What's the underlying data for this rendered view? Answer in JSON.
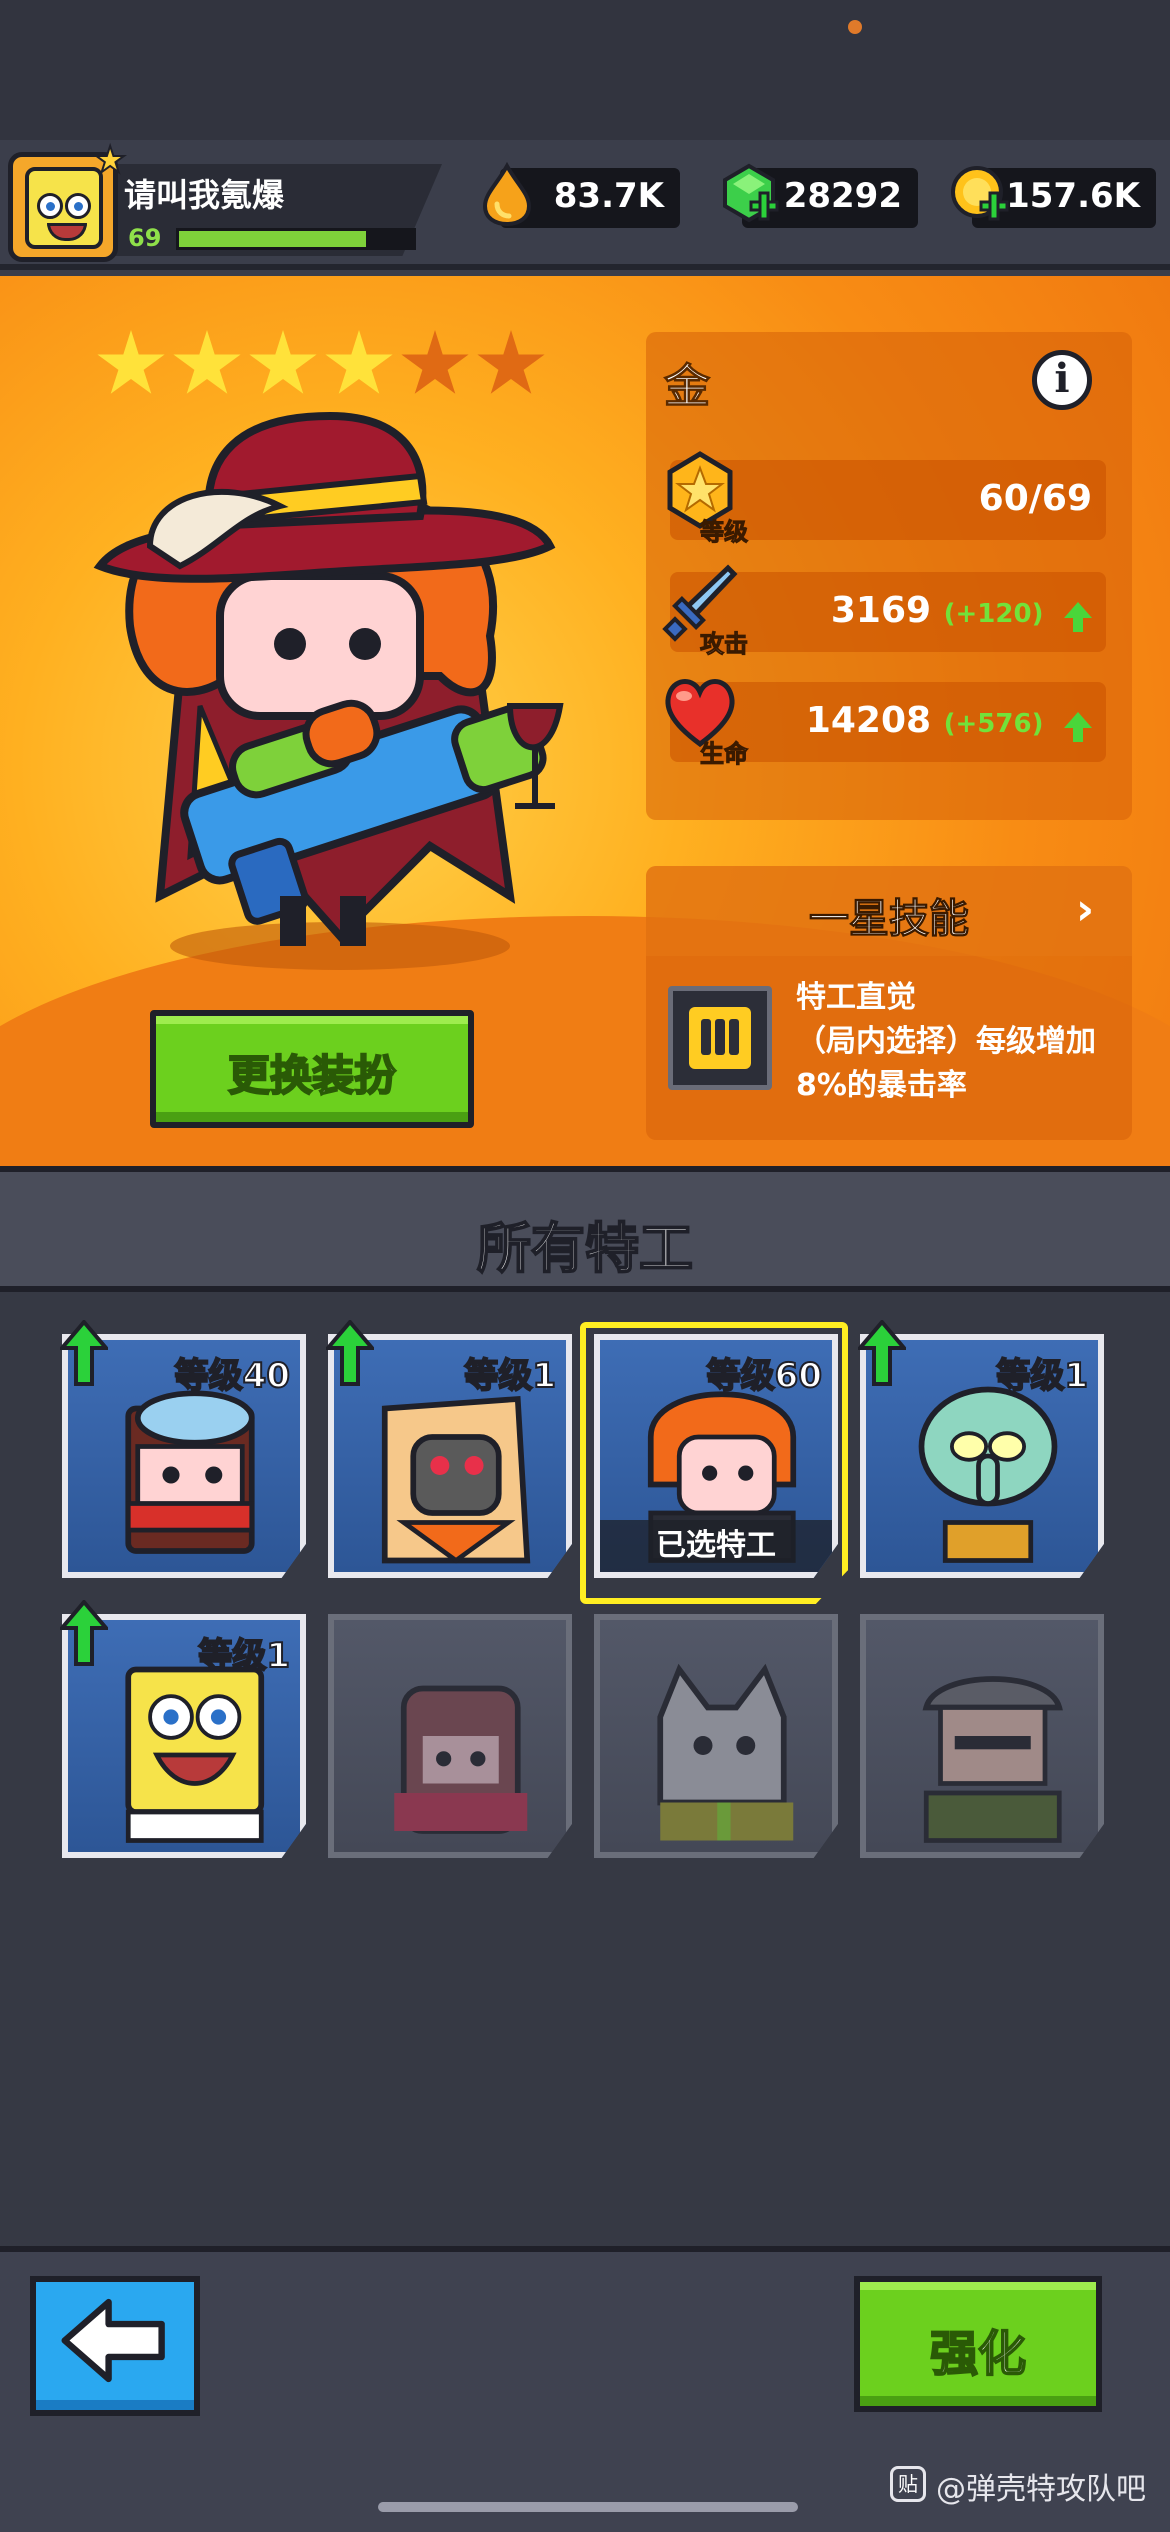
{
  "player": {
    "name": "请叫我氪爆",
    "level": "69",
    "xp_fraction": 0.8
  },
  "currencies": {
    "oil": "83.7K",
    "gems": "28292",
    "gold": "157.6K"
  },
  "hero": {
    "name": "金",
    "stars_filled": 4,
    "stars_total": 6,
    "info_glyph": "i",
    "stats": {
      "level_label": "等级",
      "level_value": "60/69",
      "attack_label": "攻击",
      "attack_value": "3169",
      "attack_bonus": "(+120)",
      "hp_label": "生命",
      "hp_value": "14208",
      "hp_bonus": "(+576)"
    },
    "skill": {
      "title": "一星技能",
      "chevron": "›",
      "description": "特工直觉\n（局内选择）每级增加8%的暴击率"
    },
    "change_skin_label": "更换装扮"
  },
  "section": {
    "title": "所有特工"
  },
  "agents": [
    {
      "level_label": "等级40",
      "upgradable": true,
      "locked": false,
      "selected": false
    },
    {
      "level_label": "等级1",
      "upgradable": true,
      "locked": false,
      "selected": false
    },
    {
      "level_label": "等级60",
      "upgradable": false,
      "locked": false,
      "selected": true,
      "selected_label": "已选特工"
    },
    {
      "level_label": "等级1",
      "upgradable": true,
      "locked": false,
      "selected": false
    },
    {
      "level_label": "等级1",
      "upgradable": true,
      "locked": false,
      "selected": false
    },
    {
      "level_label": "",
      "upgradable": false,
      "locked": true,
      "selected": false
    },
    {
      "level_label": "",
      "upgradable": false,
      "locked": true,
      "selected": false
    },
    {
      "level_label": "",
      "upgradable": false,
      "locked": true,
      "selected": false
    }
  ],
  "bottom": {
    "upgrade_label": "强化",
    "watermark": "@弹壳特攻队吧",
    "watermark_logo": "贴"
  },
  "colors": {
    "accent_green": "#6cd01e",
    "accent_blue": "#2aa8f0",
    "selected_frame": "#ffee22",
    "bonus_green": "#72e23a",
    "hero_bg": "#f88c14"
  }
}
